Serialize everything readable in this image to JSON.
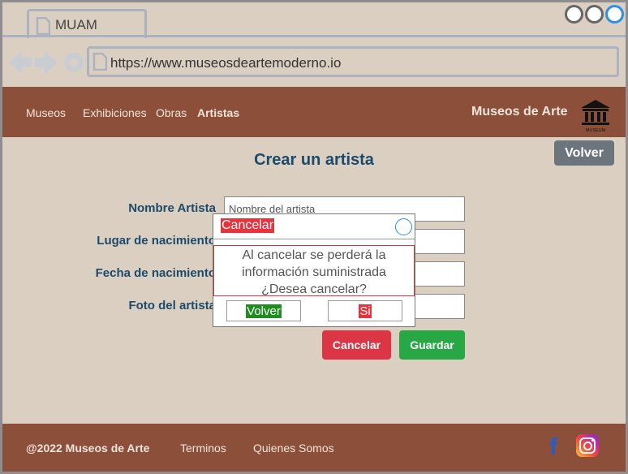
{
  "browser": {
    "tab_title": "MUAM",
    "url": "https://www.museosdeartemoderno.io"
  },
  "header": {
    "nav": [
      "Museos",
      "Exhibiciones",
      "Obras",
      "Artistas"
    ],
    "active_nav": "Artistas",
    "brand": "Museos de Arte",
    "logo_caption": "MUSEUM"
  },
  "main": {
    "title": "Crear un artista",
    "back_button": "Volver",
    "fields": [
      {
        "label": "Nombre Artista",
        "placeholder": "Nombre del artista"
      },
      {
        "label": "Lugar de nacimiento",
        "placeholder": ""
      },
      {
        "label": "Fecha de nacimiento",
        "placeholder": ""
      },
      {
        "label": "Foto del artista",
        "placeholder": ""
      }
    ],
    "cancel_button": "Cancelar",
    "save_button": "Guardar"
  },
  "modal": {
    "title": "Cancelar",
    "message_line1": "Al cancelar se perderá la",
    "message_line2": "información suministrada",
    "message_line3": "¿Desea cancelar?",
    "back_button": "Volver",
    "confirm_button": "Si"
  },
  "footer": {
    "copyright": "@2022 Museos de Arte",
    "terms": "Terminos",
    "about": "Quienes Somos",
    "social": [
      "facebook-icon",
      "instagram-icon"
    ]
  },
  "colors": {
    "page_bg": "#dbcfc2",
    "header_bg": "#8c4f3a",
    "title_text": "#1c4a6a",
    "danger": "#dc3545",
    "success": "#28a745",
    "secondary": "#6c757d"
  }
}
